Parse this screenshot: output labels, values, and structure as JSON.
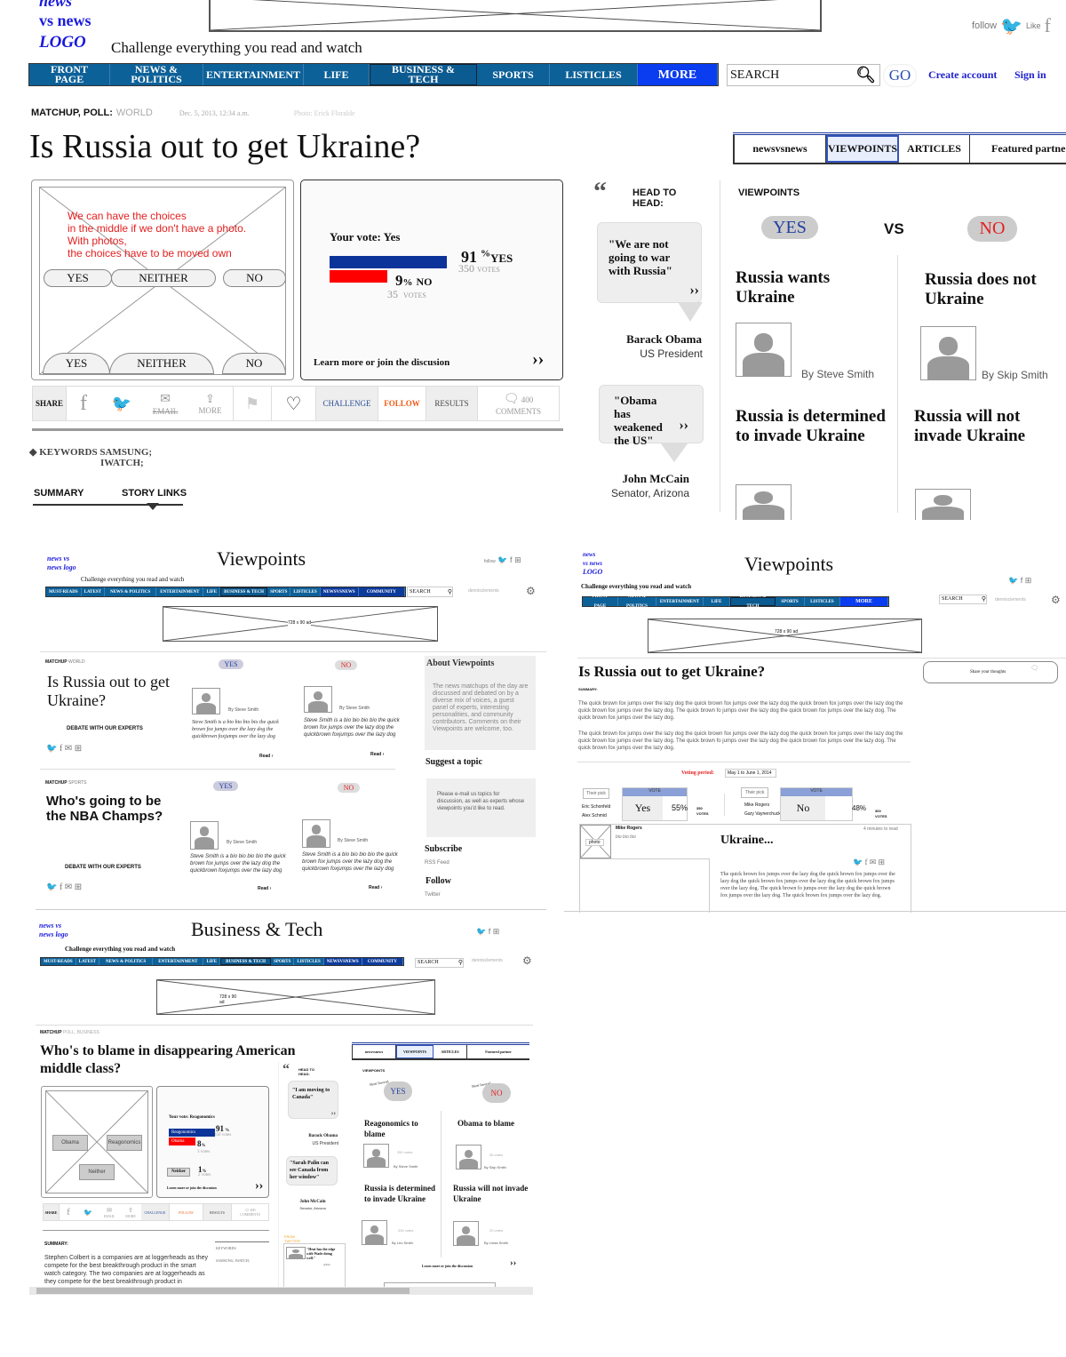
{
  "main": {
    "logo_lines": [
      "news",
      "vs news",
      "LOGO"
    ],
    "tagline": "Challenge everything you read and watch",
    "social": {
      "follow": "follow",
      "like": "Like"
    },
    "nav": [
      "FRONT PAGE",
      "NEWS & POLITICS",
      "ENTERTAINMENT",
      "LIFE",
      "BUSINESS & TECH",
      "SPORTS",
      "LISTICLES",
      "MORE"
    ],
    "search_placeholder": "SEARCH",
    "go": "GO",
    "create_account": "Create account",
    "sign_in": "Sign in",
    "meta": {
      "category": "MATCHUP, POLL:",
      "section": "WORLD",
      "date": "Dec. 5, 2013, 12:34 a.m.",
      "photo": "Photo: Erick Floralde"
    },
    "title": "Is Russia out to get Ukraine?",
    "note_lines": [
      "We can have the choices",
      "in the middle if we don't have a photo.",
      "With photos,",
      "the choices have to be moved own"
    ],
    "choices": [
      "YES",
      "NEITHER",
      "NO"
    ],
    "poll": {
      "your_vote": "Your vote: Yes",
      "yes": {
        "pct": "91",
        "label": "YES",
        "votes": "350",
        "votes_label": "VOTES",
        "share": 0.91,
        "color": "#0b3399"
      },
      "no": {
        "pct": "9",
        "label": "NO",
        "votes": "35",
        "votes_label": "VOTES",
        "share": 0.09,
        "color": "#ff0000"
      },
      "learn_more": "Learn more or join the discusion"
    },
    "share": {
      "label": "SHARE",
      "email": "EMAIL",
      "more": "MORE",
      "challenge": "CHALLENGE",
      "follow": "FOLLOW",
      "results": "RESULTS",
      "comments_count": "400",
      "comments": "COMMENTS"
    },
    "keywords": {
      "label": "KEYWORDS",
      "values": [
        "SAMSUNG;",
        "IWATCH;"
      ]
    },
    "tabs_bottom": [
      "SUMMARY",
      "STORY LINKS"
    ],
    "side_tabs": [
      "newsvsnews",
      "VIEWPOINTS",
      "ARTICLES",
      "Featured partne"
    ],
    "head_to_head": {
      "label_lines": [
        "HEAD TO",
        "HEAD:"
      ],
      "quotes": [
        {
          "text": "\"We are not going to war with Russia\"",
          "name": "Barack Obama",
          "role": "US President"
        },
        {
          "text": "\"Obama has weakened the US\"",
          "name": "John McCain",
          "role": "Senator, Arizona"
        }
      ]
    },
    "viewpoints": {
      "label": "VIEWPOINTS",
      "yes": "YES",
      "vs": "VS",
      "no": "NO",
      "yes_col": [
        {
          "title": "Russia wants Ukraine",
          "author": "By Steve Smith"
        },
        {
          "title": "Russia is determined to invade Ukraine"
        }
      ],
      "no_col": [
        {
          "title": "Russia does not Ukraine",
          "author": "By Skip Smith"
        },
        {
          "title": "Russia will not invade Ukraine"
        }
      ]
    }
  },
  "vp_list": {
    "logo": "news vs news logo",
    "page_title": "Viewpoints",
    "tagline": "Challenge everything you read and watch",
    "nav": [
      "MUST-READS",
      "LATEST",
      "NEWS & POLITICS",
      "ENTERTAINMENT",
      "LIFE",
      "BUSINESS & TECH",
      "SPORTS",
      "LISTICLES",
      "NEWSVSNEWS",
      "COMMUNITY"
    ],
    "search": "SEARCH",
    "user": "dennisclements",
    "ad": "728 x 90 ad",
    "items": [
      {
        "category": "MATCHUP",
        "section": "WORLD",
        "title": "Is Russia out to get Ukraine?",
        "debate": "DEBATE  WITH  OUR EXPERTS",
        "yes": "YES",
        "no": "NO",
        "yes_author": "By Steve Smith",
        "no_author": "By Steve Smith",
        "bio": "Steve Smith is a bio bio bio bio the quick brown fox jumps over the lazy dog the quickbrown foxjumps over the lazy dog",
        "read": "Read"
      },
      {
        "category": "MATCHUP",
        "section": "SPORTS",
        "title": "Who's going to be the NBA Champs?",
        "debate": "DEBATE  WITH  OUR EXPERTS",
        "yes": "YES",
        "no": "NO",
        "yes_author": "By Steve Smith",
        "no_author": "By Steve Smith",
        "bio": "Steve Smith is a bio bio bio bio the quick brown fox jumps over the lazy dog the quickbrown foxjumps over the lazy dog",
        "read": "Read"
      }
    ],
    "about_title": "About Viewpoints",
    "about_text": "The news matchups of the day are discussed and debated on by a diverse mix of voices, a guest panel of experts, interesting personalities, and community contributors. Comments on their Viewpoints are welcome, too.",
    "suggest_title": "Suggest a topic",
    "suggest_text": "Please e-mail us topics for discussion, as well as experts whose viewpoints you'd like to read.",
    "subscribe_title": "Subscribe",
    "rss": "RSS Feed",
    "follow_title": "Follow",
    "twitter": "Twitter"
  },
  "vp_detail": {
    "logo_lines": [
      "news",
      "vs news",
      "LOGO"
    ],
    "page_title": "Viewpoints",
    "tagline": "Challenge everything you read and watch",
    "nav": [
      "FRONT PAGE",
      "NEWS & POLITICS",
      "ENTERTAINMENT",
      "LIFE",
      "BUSINESS & TECH",
      "SPORTS",
      "LISTICLES",
      "MORE"
    ],
    "search": "SEARCH",
    "user": "dennisclements",
    "ad": "728 x 90 ad",
    "title": "Is Russia out to get Ukraine?",
    "share_thoughts": "Share your thoughts",
    "summary_label": "SUMMARY:",
    "paragraph": "The quick brown fox jumps over the lazy dog the quick brown fox jumps over the lazy dog the quick brown fox jumps over the lazy dog the quick brown fox jumps over the lazy dog. The quick brown fo jumps over the lazy dog the quick brown fox jumps over the lazy dog. The quick brown fox jumps over the lazy dog.",
    "voting_label": "Voting period:",
    "voting_value": "May 1 to June 1, 2014",
    "their_pick": "Their pick",
    "vote_header": "VOTE",
    "yes_side": {
      "names": [
        "Eric Schonfeld",
        "Alex Schmid"
      ],
      "choice": "Yes",
      "pct": "55%",
      "votes": "350",
      "votes_label": "VOTES"
    },
    "no_side": {
      "names": [
        "Mike Rogers",
        "Gary Vaynerchuck"
      ],
      "choice": "No",
      "pct": "48%",
      "votes": "300",
      "votes_label": "VOTES"
    },
    "article": {
      "author": "Mike Rogers",
      "bio": "bio bio bio",
      "photo": "photo",
      "read_time": "4 minutes to read",
      "title": "Ukraine...",
      "body": "The quick brown fox jumps over the lazy dog the quick brown fox jumps over the lazy dog the quick brown fox jumps over the lazy dog the quick brown fox jumps over the lazy dog. The quick brown fo jumps over the lazy dog the quick brown fox jumps over the lazy dog. The quick brown fox jumps over the lazy dog."
    }
  },
  "biz": {
    "logo": "news vs news logo",
    "page_title": "Business & Tech",
    "tagline": "Challenge everything you read and watch",
    "nav": [
      "MUST-READS",
      "LATEST",
      "NEWS & POLITICS",
      "ENTERTAINMENT",
      "LIFE",
      "BUSINESS & TECH",
      "SPORTS",
      "LISTICLES",
      "NEWSVSNEWS",
      "COMMUNITY"
    ],
    "search": "SEARCH",
    "user": "dennisclements",
    "ad": "728 x 90 ad",
    "category": "MATCHUP",
    "section": "POLL, BUSINESS",
    "title": "Who's to blame in disappearing American middle class?",
    "choices": [
      "Obama",
      "Reagonomics",
      "Neither"
    ],
    "poll": {
      "your_vote": "Your vote: Reagonomics",
      "rows": [
        {
          "label": "Reagonomics",
          "pct": "91",
          "votes": "350",
          "share": 0.91,
          "color": "#0b3399"
        },
        {
          "label": "Obama",
          "pct": "8",
          "votes": "3",
          "share": 0.08,
          "color": "#ff0000"
        },
        {
          "label": "Neither",
          "pct": "1",
          "votes": "2",
          "share": 0.01,
          "color": "#dddddd"
        }
      ],
      "votes_label": "votes",
      "learn_more": "Learn more or join the discusion"
    },
    "share": {
      "label": "SHARE",
      "email": "EMAIL",
      "more": "MORE",
      "challenge": "CHALLENGE",
      "follow": "FOLLOW",
      "results": "RESULTS",
      "comments_count": "400",
      "comments": "COMMENTS"
    },
    "summary_label": "SUMMARY:",
    "summary": "Stephen Colbert is a companies are at loggerheads as they compete for the best breakthrough product in the smart watch category. The two companies are at loggerheads as they compete for the best breakthrough product in",
    "keywords_label": "KEYWORDS",
    "keywords": "SAMSUNG; IWATCH;",
    "head_to_head": {
      "label_lines": [
        "HEAD TO",
        "HEAD:"
      ],
      "quotes": [
        {
          "text": "\"I am moving to Canada\"",
          "name": "Barack Obama",
          "role": "US President"
        },
        {
          "text": "\"Sarah Palin can see Canada from her window\"",
          "name": "John McCain",
          "role": "Senator, Arizona"
        }
      ]
    },
    "from_twitter": "FROM TWITTER",
    "tweet": "\"Heat has the edge with Wade doing well.\"",
    "tweet_handle": "@Enit",
    "side_tabs": [
      "newsvsnews",
      "VIEWPOINTS",
      "ARTICLES",
      "Featured partner"
    ],
    "viewpoints": {
      "label": "VIEWPOINTS",
      "most_favored": "Most favored",
      "yes": "YES",
      "no": "NO",
      "cards": [
        {
          "title": "Reagonomics to blame",
          "votes": "350",
          "author": "By Steve Smith"
        },
        {
          "title": "Obama to blame",
          "votes": "35",
          "author": "By Skip Smith"
        },
        {
          "title": "Russia is determined to invade Ukraine",
          "votes": "200",
          "author": "By Leo Smith"
        },
        {
          "title": "Russia will not invade Ukraine",
          "votes": "20",
          "author": "By Linda Smith"
        }
      ],
      "votes_label": "votes",
      "learn_more": "Learn more or join the discussion"
    }
  }
}
